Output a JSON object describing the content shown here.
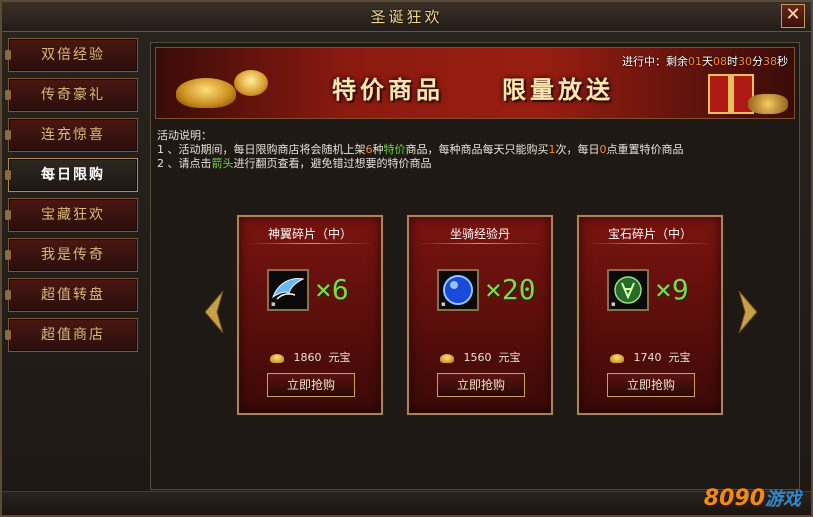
{
  "window": {
    "title": "圣诞狂欢",
    "close_label": "✕"
  },
  "sidebar": {
    "items": [
      {
        "label": "双倍经验"
      },
      {
        "label": "传奇豪礼"
      },
      {
        "label": "连充惊喜"
      },
      {
        "label": "每日限购"
      },
      {
        "label": "宝藏狂欢"
      },
      {
        "label": "我是传奇"
      },
      {
        "label": "超值转盘"
      },
      {
        "label": "超值商店"
      }
    ],
    "active_index": 3
  },
  "banner": {
    "title_left": "特价商品",
    "title_right": "限量放送",
    "countdown": {
      "prefix": "进行中：剩余",
      "days": "01",
      "days_unit": "天",
      "hours": "08",
      "hours_unit": "时",
      "minutes": "30",
      "minutes_unit": "分",
      "seconds": "38",
      "seconds_unit": "秒"
    }
  },
  "description": {
    "heading": "活动说明：",
    "line1_a": "1 、活动期间，每日限购商店将会随机上架",
    "line1_num": "6",
    "line1_b": "种",
    "line1_hl": "特价",
    "line1_c": "商品，每种商品每天只能购买",
    "line1_num2": "1",
    "line1_d": "次，每日",
    "line1_num3": "0",
    "line1_e": "点重置特价商品",
    "line2_a": "2 、请点击",
    "line2_hl": "箭头",
    "line2_b": "进行翻页查看，避免错过想要的特价商品"
  },
  "products": [
    {
      "name": "神翼碎片（中）",
      "quantity": "×6",
      "price": "1860",
      "currency": "元宝",
      "buy_label": "立即抢购",
      "icon": "wing-fragment-icon"
    },
    {
      "name": "坐骑经验丹",
      "quantity": "×20",
      "price": "1560",
      "currency": "元宝",
      "buy_label": "立即抢购",
      "icon": "mount-exp-pill-icon"
    },
    {
      "name": "宝石碎片（中）",
      "quantity": "×9",
      "price": "1740",
      "currency": "元宝",
      "buy_label": "立即抢购",
      "icon": "gem-fragment-icon"
    }
  ],
  "watermark": {
    "part1": "8090",
    "part2": "游戏"
  },
  "colors": {
    "accent_green": "#7fd84a",
    "accent_orange": "#ff8a2a",
    "gold": "#f2d58c",
    "card_red": "#7a1410"
  }
}
